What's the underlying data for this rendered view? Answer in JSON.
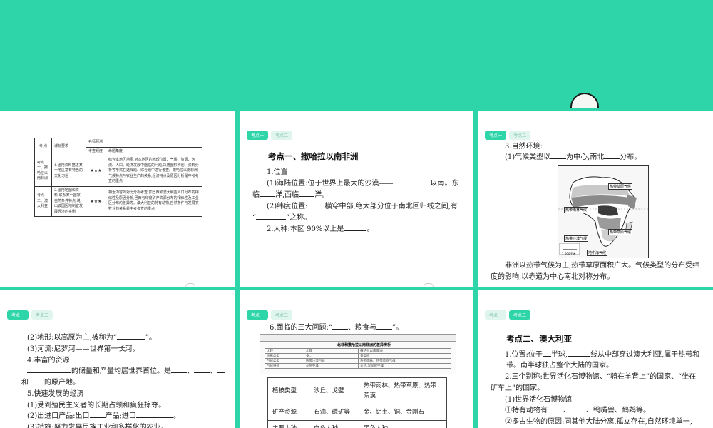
{
  "tabs": {
    "kaodian1": "考点一",
    "kaodian2": "考点二"
  },
  "slide1": {
    "headers": {
      "kaodian": "考 点",
      "kebiao": "课标要求",
      "mingshi": "名师预测",
      "kaocha": "考查频度",
      "mingti": "命题角度"
    },
    "rows": [
      {
        "kaodian": "考点一、撒哈拉以南非洲",
        "kebiao": "1.运用资料描述某一地区富有特色的文化习俗",
        "stars": "★★★",
        "mingti": "结合本地区地图,对本地区的地理位置、气候、资源、河流、人口、经济发展中面临的问题,采用图形辨别、资料分析等形式在选择题、综合题中进行考查。撒哈拉以南非洲气候特点与农业生产的关系,经济特点及原因分析是中考考查的重点"
      },
      {
        "kaodian": "考点二、澳大利亚",
        "kebiao": "2.运用地图和资料,联系某一国家自然条件特点,说出该国因地制宜发展经济的实例",
        "stars": "★★★",
        "mingti": "相近内容的对比分析考查,如巴西和澳大利亚人口分布的相似性及原因分析,巴西与印度矿产资源分布的相似性及工业区分布的差异等。澳大利亚的特有动物,自然条件与发展农牧业的关系是中考考查的重点"
      }
    ]
  },
  "slide2": {
    "heading": "考点一、撒哈拉以南非洲",
    "s1": "1.位置",
    "l1a": "(1)海陆位置:位于世界上最大的沙漠——",
    "l1b": "以南。东",
    "l2a": "临",
    "l2b": "洋,西临",
    "l2c": "洋。",
    "l3a": "(2)纬度位置:",
    "l3b": "横穿中部,绝大部分位于南北回归线之间,有",
    "l4a": "“",
    "l4b": "”之称。",
    "l5a": "2.人种:本区 90%以上是",
    "l5b": "。"
  },
  "slide3": {
    "s1": "3.自然环境:",
    "l1a": "(1)气候类型以",
    "l1b": "为中心,南北",
    "l1c": "分布。",
    "map": {
      "label1": "热带草原气候",
      "label2": "热带雨林气候",
      "label3": "热带草原气候",
      "label4": "热带沙漠气候",
      "label5": "地中海气候",
      "scale": "1 000千米"
    },
    "p1": "非洲以热带气候为主,热带草原面积广大。气候类型的分布受纬",
    "p2": "度的影响,以赤道为中心南北对称分布。"
  },
  "slide4": {
    "l1a": "(2)地形:以高原为主,被称为“",
    "l1b": "”。",
    "l2": "(3)河流:尼罗河——世界第一长河。",
    "l3": "4.丰富的资源",
    "l4a": "的储量和产量均居世界首位。是",
    "l4b": "、",
    "l4c": "、",
    "l5a": "和",
    "l5b": "的原产地。",
    "l6": "5.快速发展的经济",
    "l7": "(1)受到殖民主义者的长期占领和疯狂掠夺。",
    "l8a": "(2)出进口产品:出口",
    "l8b": "产品;进口",
    "l8c": "。",
    "l9": "(3)措施:努力发展民族工业和多样化的农业。"
  },
  "slide5": {
    "l1a": "6.面临的三大问题:“",
    "l1b": "、粮食与",
    "l1c": "”。",
    "mini_title": "北非和撒哈拉以南非洲的差异辨析",
    "mini_rows": [
      [
        "比较",
        "北非",
        "撒哈拉以南非洲"
      ],
      [
        "地形类型",
        "多…",
        "多高原"
      ],
      [
        "气候类型",
        "热带沙漠气候",
        "热带雨林、热带草原气候"
      ],
      [
        "气候特征",
        "炎热干燥",
        "炎热,湿润或干燥"
      ]
    ],
    "rows": [
      {
        "a": "植被类型",
        "b": "沙丘、戈壁",
        "c": "热带雨林、热带草原、热带荒漠"
      },
      {
        "a": "矿产资源",
        "b": "石油、磷矿等",
        "c": "金、铝土、铜、金刚石"
      },
      {
        "a": "主要人种",
        "b": "白色人种",
        "c": "黑色人种"
      }
    ]
  },
  "slide6": {
    "heading": "考点二、澳大利亚",
    "l1a": "1.位置:位于",
    "l1b": "半球,",
    "l1c": "线从中部穿过澳大利亚,属于热带和",
    "l2a": "带。南半球独占整个大陆的国家。",
    "l3": "2.三个别称:世界活化石博物馆、“骑在羊背上”的国家、“坐在",
    "l4": "矿车上”的国家。",
    "l5": "(1)世界活化石博物馆",
    "l6a": "①特有动物有",
    "l6b": "、",
    "l6c": "、鸭嘴兽、鸸鹋等。",
    "l7": "②多古生物的原因:同其他大陆分离,孤立存在,自然环境单一,"
  }
}
